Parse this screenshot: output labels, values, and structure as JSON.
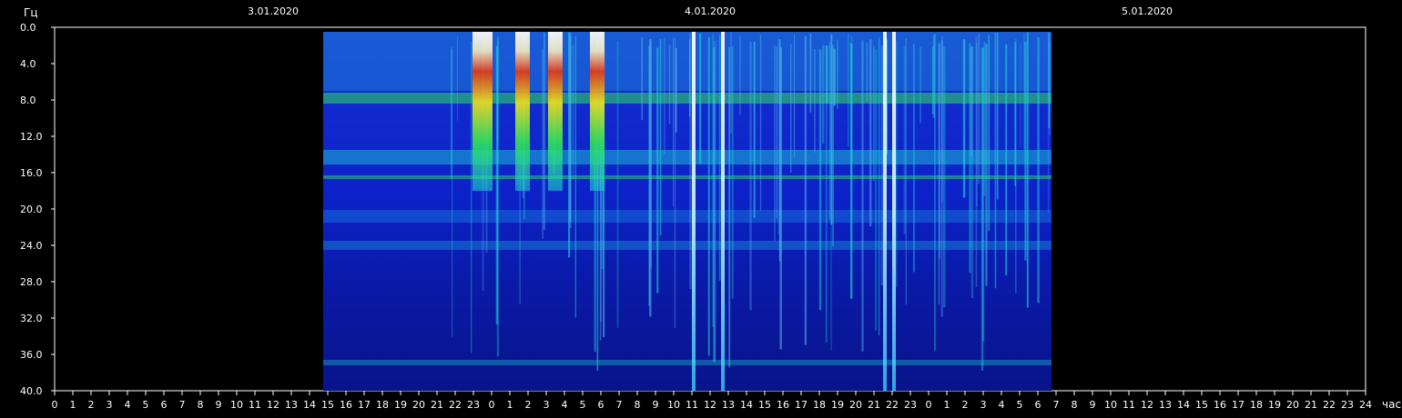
{
  "chart_data": {
    "type": "heatmap",
    "ylabel": "Гц",
    "xlabel": "час",
    "ylim": [
      0,
      40
    ],
    "y_ticks": [
      "0.0",
      "4.0",
      "8.0",
      "12.0",
      "16.0",
      "20.0",
      "24.0",
      "28.0",
      "32.0",
      "36.0",
      "40.0"
    ],
    "x_ticks": [
      "0",
      "1",
      "2",
      "3",
      "4",
      "5",
      "6",
      "7",
      "8",
      "9",
      "10",
      "11",
      "12",
      "13",
      "14",
      "15",
      "16",
      "17",
      "18",
      "19",
      "20",
      "21",
      "22",
      "23",
      "0",
      "1",
      "2",
      "3",
      "4",
      "5",
      "6",
      "7",
      "8",
      "9",
      "10",
      "11",
      "12",
      "13",
      "14",
      "15",
      "16",
      "17",
      "18",
      "19",
      "20",
      "21",
      "22",
      "23",
      "0",
      "1",
      "2",
      "3",
      "4",
      "5",
      "6",
      "7",
      "8",
      "9",
      "10",
      "11",
      "12",
      "13",
      "14",
      "15",
      "16",
      "17",
      "18",
      "19",
      "20",
      "21",
      "22",
      "23",
      "24"
    ],
    "dates": [
      "3.01.2020",
      "4.01.2020",
      "5.01.2020"
    ],
    "x_range_hours": [
      0,
      72
    ],
    "data_range_hours": [
      14.75,
      54.75
    ],
    "colors": {
      "background": "#000000",
      "low": "#0a1fb8",
      "mid": "#1a7fe0",
      "cyan": "#21d4d8",
      "green": "#2ee05a",
      "yellow": "#e8e020",
      "red": "#d02010",
      "white": "#ffffff"
    },
    "bands_hz": [
      7.8,
      14.3,
      16.5,
      20.8,
      24,
      36.9
    ],
    "bursts_hours": [
      23.5,
      25.7,
      27.5,
      29.8,
      35.1,
      36.7,
      45.6,
      46.1
    ]
  }
}
